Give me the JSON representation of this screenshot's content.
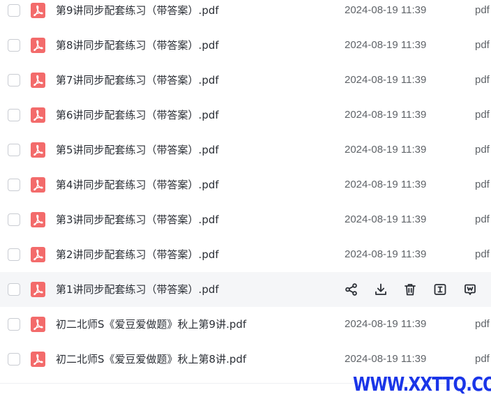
{
  "files": [
    {
      "name": "第9讲同步配套练习（带答案）.pdf",
      "date": "2024-08-19 11:39",
      "type": "pdf"
    },
    {
      "name": "第8讲同步配套练习（带答案）.pdf",
      "date": "2024-08-19 11:39",
      "type": "pdf"
    },
    {
      "name": "第7讲同步配套练习（带答案）.pdf",
      "date": "2024-08-19 11:39",
      "type": "pdf"
    },
    {
      "name": "第6讲同步配套练习（带答案）.pdf",
      "date": "2024-08-19 11:39",
      "type": "pdf"
    },
    {
      "name": "第5讲同步配套练习（带答案）.pdf",
      "date": "2024-08-19 11:39",
      "type": "pdf"
    },
    {
      "name": "第4讲同步配套练习（带答案）.pdf",
      "date": "2024-08-19 11:39",
      "type": "pdf"
    },
    {
      "name": "第3讲同步配套练习（带答案）.pdf",
      "date": "2024-08-19 11:39",
      "type": "pdf"
    },
    {
      "name": "第2讲同步配套练习（带答案）.pdf",
      "date": "2024-08-19 11:39",
      "type": "pdf"
    },
    {
      "name": "第1讲同步配套练习（带答案）.pdf",
      "hovered": true
    },
    {
      "name": "初二北师S《爱豆爱做题》秋上第9讲.pdf",
      "date": "2024-08-19 11:39",
      "type": "pdf"
    },
    {
      "name": "初二北师S《爱豆爱做题》秋上第8讲.pdf",
      "date": "2024-08-19 11:39",
      "type": "pdf"
    }
  ],
  "row_actions": [
    "share-icon",
    "download-icon",
    "delete-icon",
    "rename-icon",
    "more-icon"
  ],
  "watermark": "WWW.XXTTQ.COM",
  "colors": {
    "pdf_icon": "#f36b6b",
    "hover_row": "#f5f6f8",
    "watermark": "#1a35e8",
    "text": "#2b2f36",
    "muted": "#5f6368"
  }
}
